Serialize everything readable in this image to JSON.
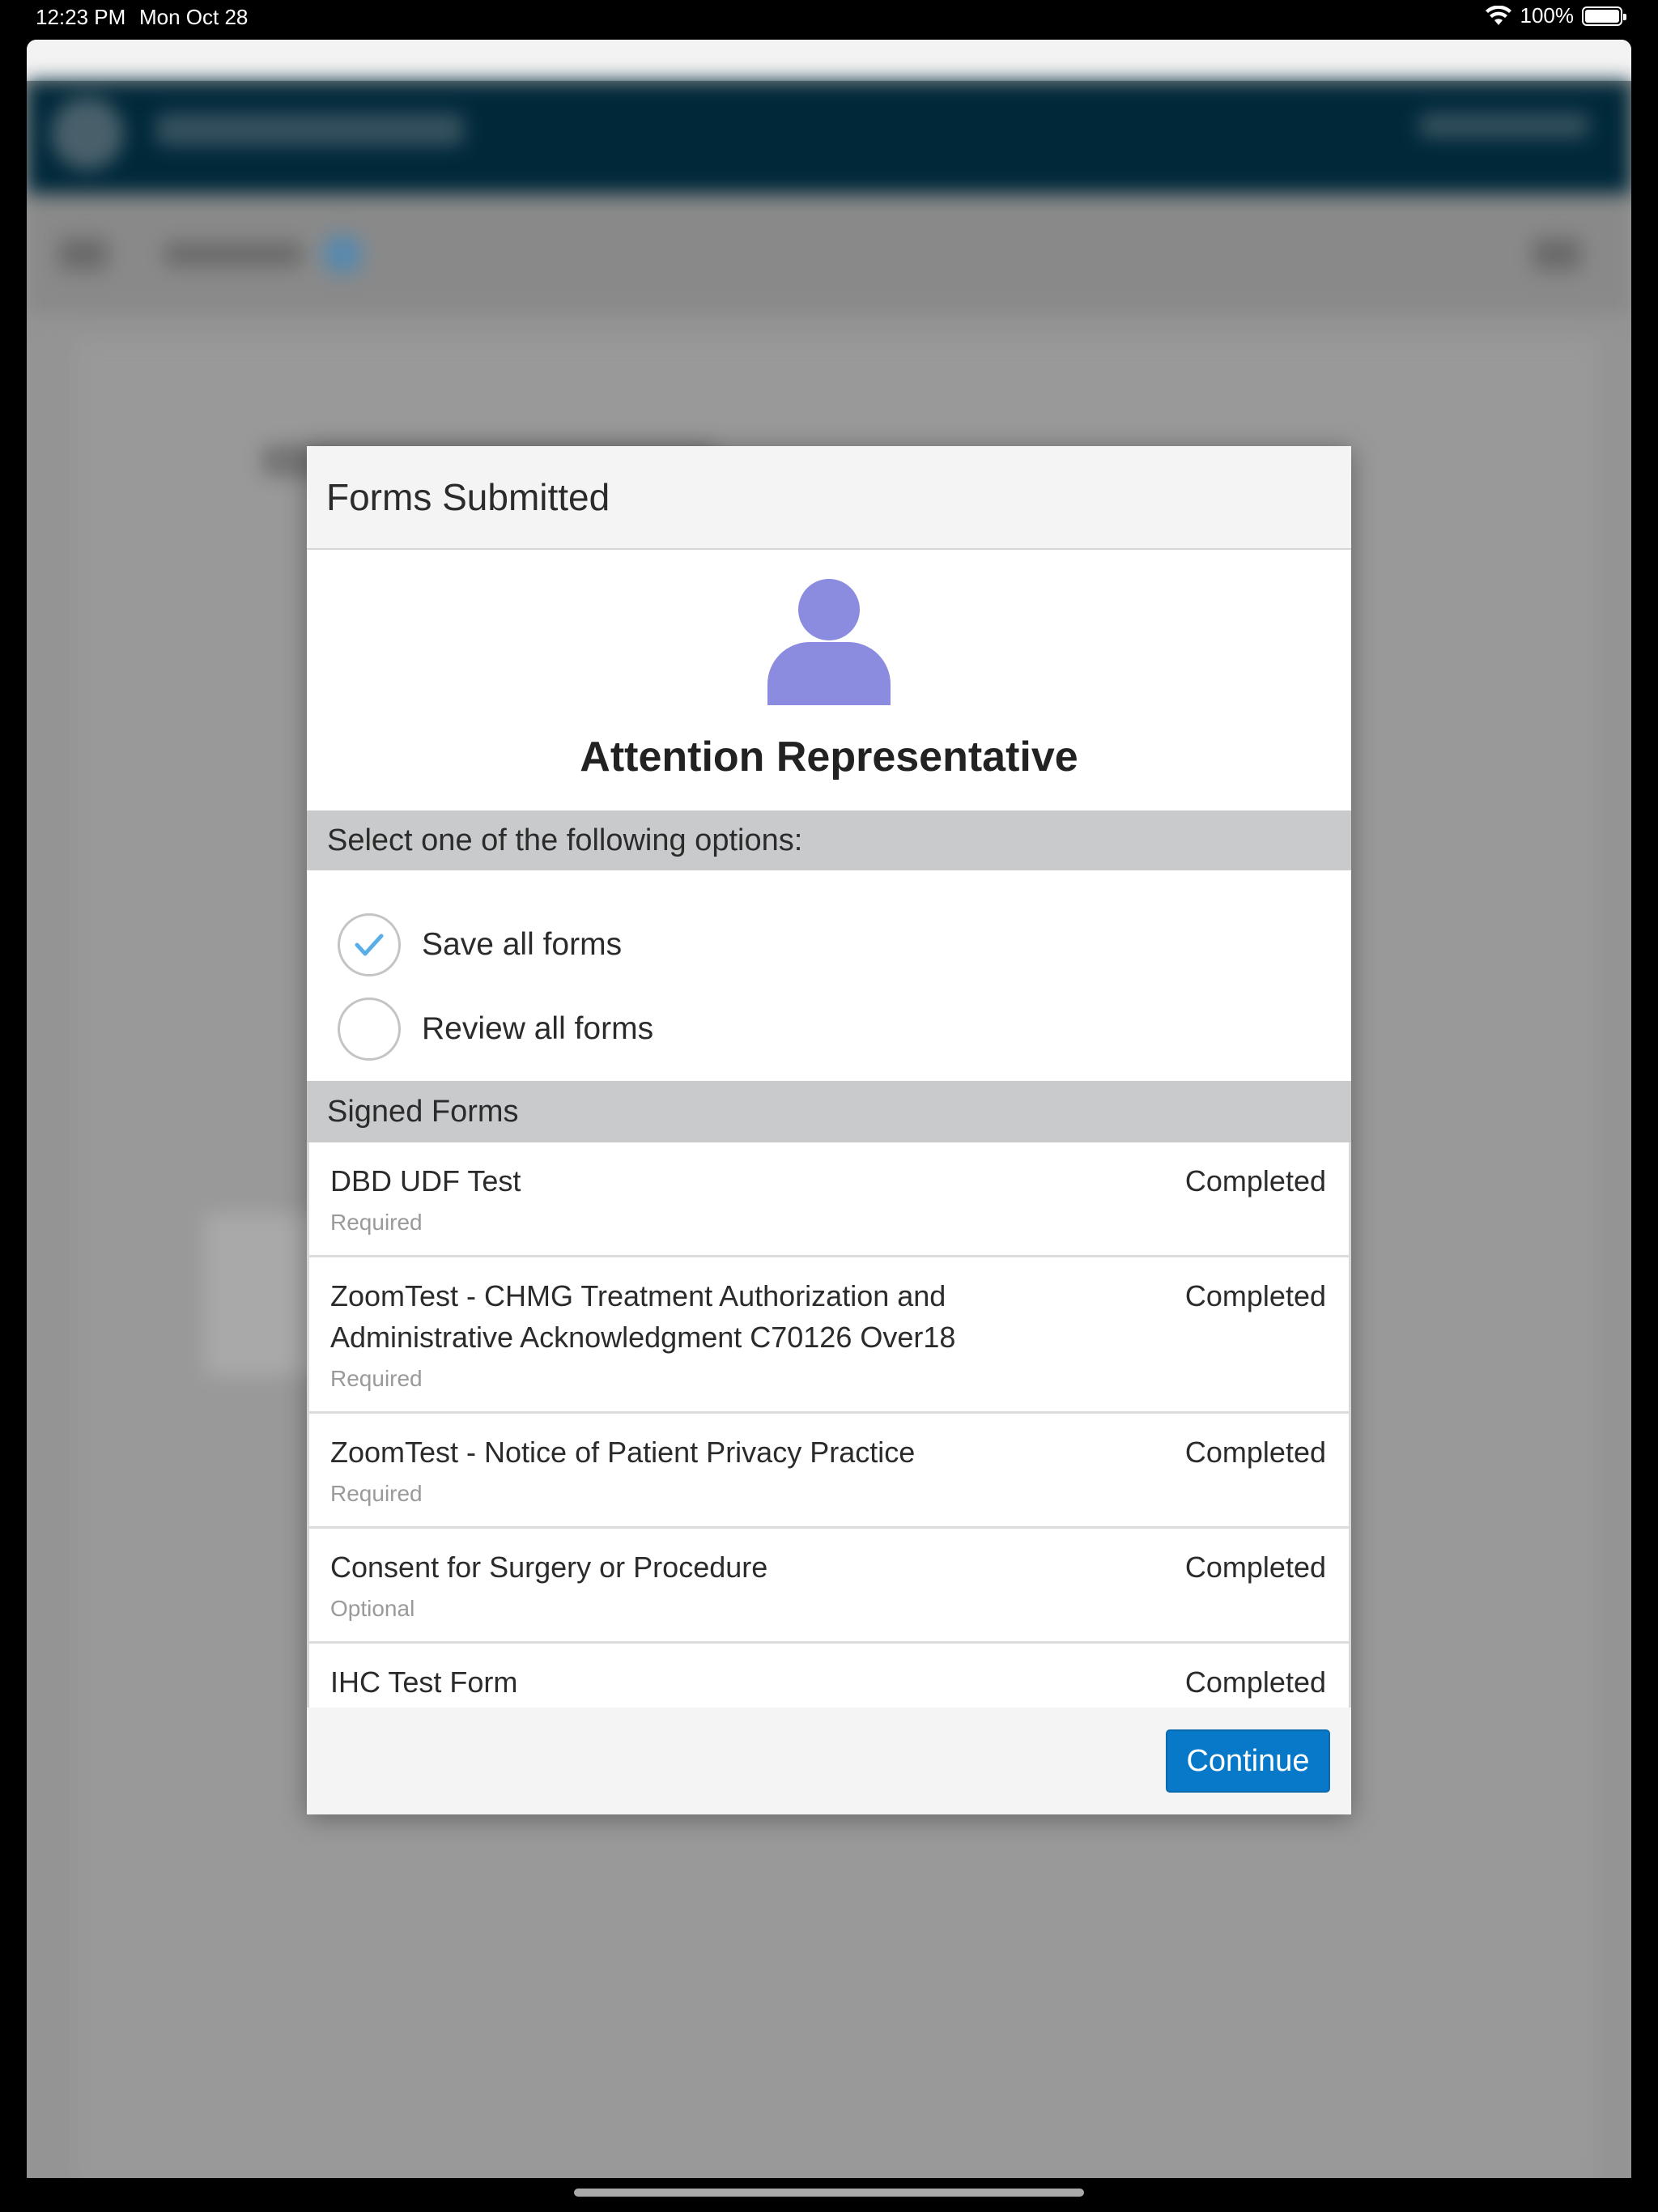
{
  "status_bar": {
    "time": "12:23 PM",
    "date": "Mon Oct 28",
    "battery": "100%",
    "wifi_icon": "wifi-icon",
    "battery_icon": "battery-icon"
  },
  "modal": {
    "title": "Forms Submitted",
    "icon": "person-icon",
    "icon_color": "#8b8be0",
    "heading": "Attention Representative",
    "options_header": "Select one of the following options:",
    "options": [
      {
        "label": "Save all forms",
        "selected": true
      },
      {
        "label": "Review all forms",
        "selected": false
      }
    ],
    "signed_header": "Signed Forms",
    "forms": [
      {
        "name": "DBD UDF Test",
        "requirement": "Required",
        "status": "Completed"
      },
      {
        "name": "ZoomTest - CHMG Treatment Authorization and Administrative Acknowledgment C70126 Over18",
        "requirement": "Required",
        "status": "Completed"
      },
      {
        "name": "ZoomTest - Notice of Patient Privacy Practice",
        "requirement": "Required",
        "status": "Completed"
      },
      {
        "name": "Consent for Surgery or Procedure",
        "requirement": "Optional",
        "status": "Completed"
      },
      {
        "name": "IHC Test Form",
        "requirement": "",
        "status": "Completed"
      }
    ],
    "continue_label": "Continue",
    "accent_color": "#0879c8",
    "check_color": "#5aaee8"
  }
}
